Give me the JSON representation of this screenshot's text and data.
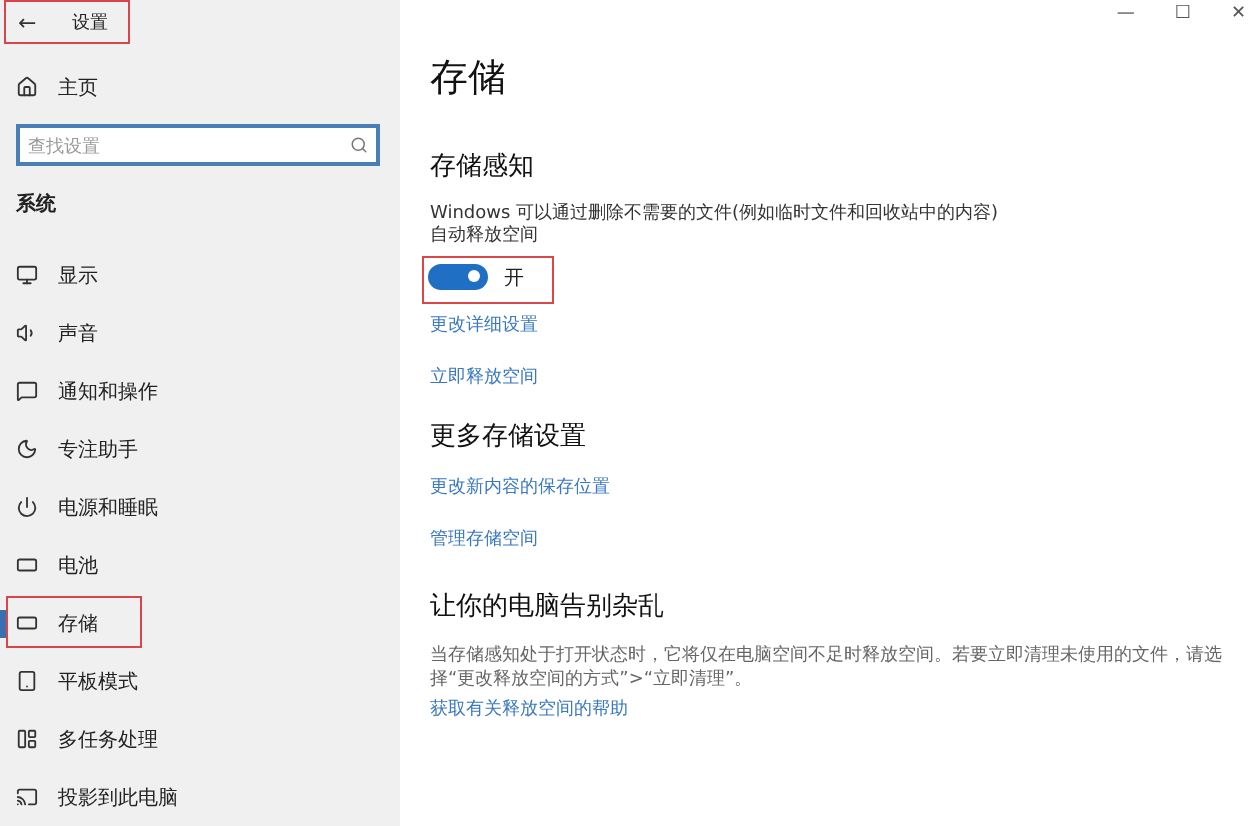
{
  "window": {
    "title": "设置",
    "back": "←",
    "annotated": true,
    "controls": [
      "—",
      "☐",
      "✕"
    ]
  },
  "sidebar": {
    "home": "主页",
    "search": {
      "placeholder": "查找设置"
    },
    "section": "系统",
    "items": [
      {
        "label": "显示",
        "selected": false,
        "annotated": false
      },
      {
        "label": "声音",
        "selected": false,
        "annotated": false
      },
      {
        "label": "通知和操作",
        "selected": false,
        "annotated": false
      },
      {
        "label": "专注助手",
        "selected": false,
        "annotated": false
      },
      {
        "label": "电源和睡眠",
        "selected": false,
        "annotated": false
      },
      {
        "label": "电池",
        "selected": false,
        "annotated": false
      },
      {
        "label": "存储",
        "selected": true,
        "annotated": true
      },
      {
        "label": "平板模式",
        "selected": false,
        "annotated": false
      },
      {
        "label": "多任务处理",
        "selected": false,
        "annotated": false
      },
      {
        "label": "投影到此电脑",
        "selected": false,
        "annotated": false
      }
    ]
  },
  "page": {
    "title": "存储",
    "sections": [
      {
        "heading": "存储感知",
        "description": "Windows 可以通过删除不需要的文件(例如临时文件和回收站中的内容)自动释放空间",
        "toggle": {
          "on": true,
          "label": "开",
          "annotated": true
        },
        "links": [
          "更改详细设置",
          "立即释放空间"
        ]
      },
      {
        "heading": "更多存储设置",
        "links": [
          "更改新内容的保存位置",
          "管理存储空间"
        ]
      },
      {
        "heading": "让你的电脑告别杂乱",
        "note": "当存储感知处于打开状态时，它将仅在电脑空间不足时释放空间。若要立即清理未使用的文件，请选择“更改释放空间的方式”>“立即清理”。",
        "links": [
          "获取有关释放空间的帮助"
        ]
      }
    ]
  }
}
